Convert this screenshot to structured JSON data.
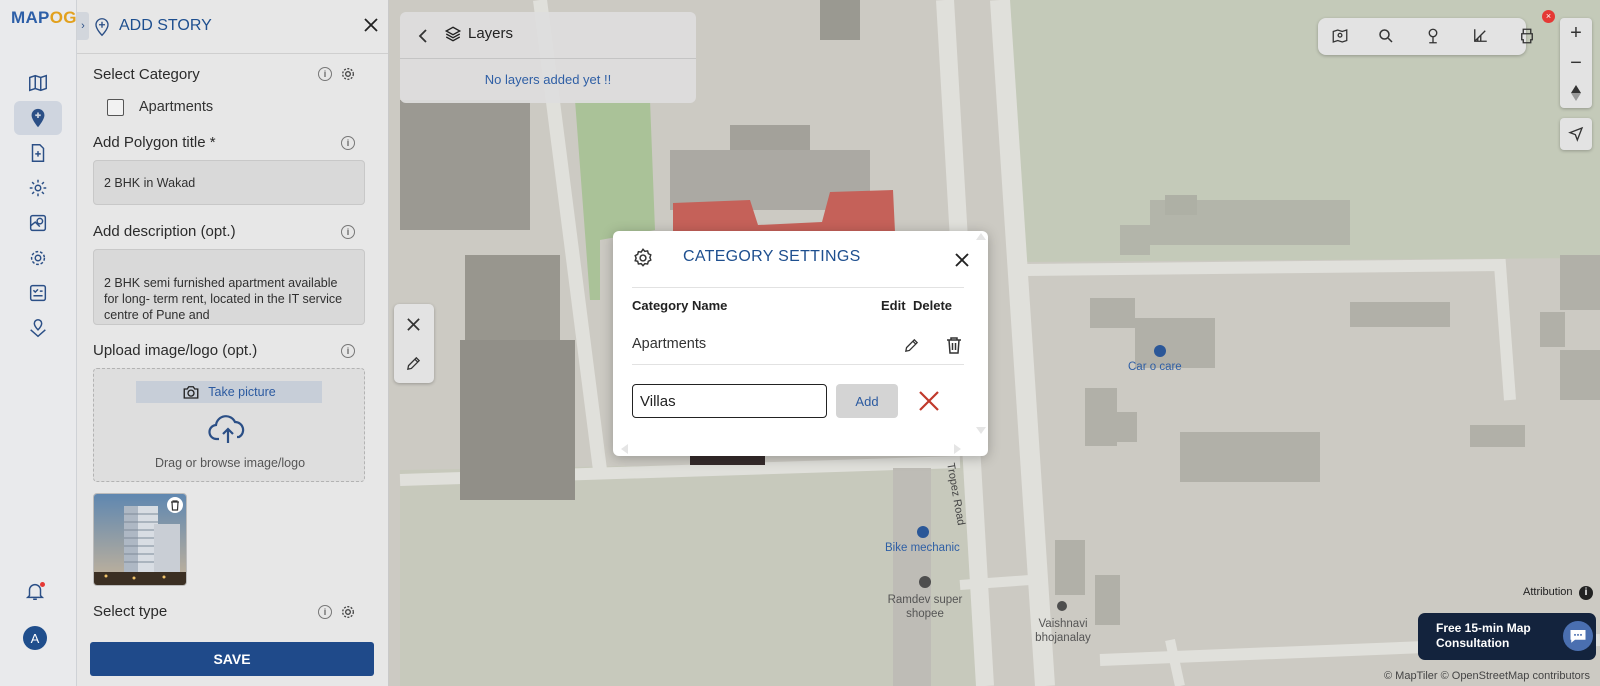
{
  "app": {
    "logo_main": "MAP",
    "logo_accent": "OG"
  },
  "rail": {
    "items": [
      {
        "icon": "map-icon"
      },
      {
        "icon": "location-pin-icon",
        "active": true
      },
      {
        "icon": "file-add-icon"
      },
      {
        "icon": "settings-icon"
      },
      {
        "icon": "map-layer-icon"
      },
      {
        "icon": "gear-icon"
      },
      {
        "icon": "checklist-icon"
      },
      {
        "icon": "map-marker-icon"
      }
    ],
    "avatar_initial": "A"
  },
  "panel": {
    "title": "ADD STORY",
    "select_category_label": "Select Category",
    "category_option": "Apartments",
    "polygon_title_label": "Add Polygon title *",
    "polygon_title_value": "2 BHK in Wakad",
    "description_label": "Add description (opt.)",
    "description_value": "2 BHK semi furnished apartment available for long- term rent, located in the IT service centre of Pune and",
    "upload_label": "Upload image/logo (opt.)",
    "take_picture": "Take picture",
    "drag_text": "Drag or browse image/logo",
    "select_type_label": "Select type",
    "save": "SAVE"
  },
  "layers": {
    "title": "Layers",
    "empty_text": "No layers added yet !!"
  },
  "toolbar": {
    "badge": "×",
    "icons": [
      "map-view-icon",
      "search-icon",
      "pin-icon",
      "measure-icon",
      "print-icon"
    ]
  },
  "zoom": {
    "in": "+",
    "out": "−"
  },
  "modal": {
    "title": "CATEGORY SETTINGS",
    "col_name": "Category Name",
    "col_edit": "Edit",
    "col_delete": "Delete",
    "rows": [
      {
        "name": "Apartments"
      }
    ],
    "input_value": "Villas",
    "add": "Add"
  },
  "map_labels": {
    "car_care": "Car o care",
    "bike_mechanic": "Bike mechanic",
    "ramdev": "Ramdev super shopee",
    "vaishnavi": "Vaishnavi bhojanalay",
    "road": "Tropez Road"
  },
  "attribution": {
    "label": "Attribution",
    "info": "i",
    "credits": "© MapTiler © OpenStreetMap contributors"
  },
  "consult": {
    "text": "Free 15-min Map Consultation"
  },
  "colors": {
    "accent": "#1e4f8f",
    "save": "#1f4a8a",
    "danger": "#c0392b"
  }
}
